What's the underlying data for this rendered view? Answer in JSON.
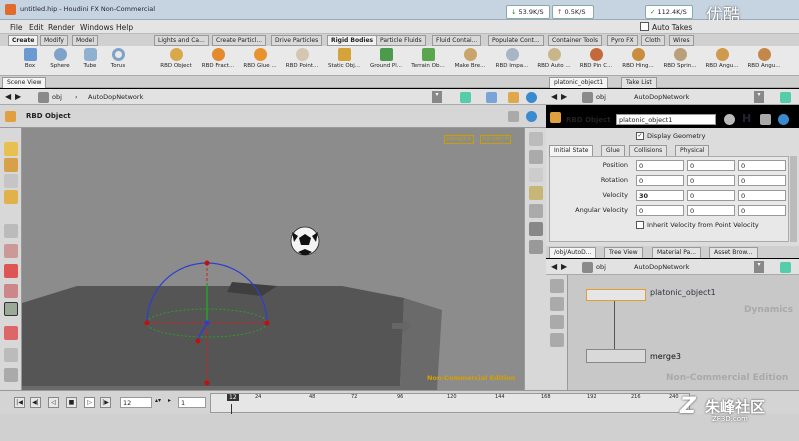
{
  "window": {
    "title": "untitled.hip - Houdini FX Non-Commercial",
    "net_down": "53.9K/S",
    "net_up": "0.5K/S",
    "net_third": "112.4K/S",
    "watermark_top": "优酷"
  },
  "menu": [
    "File",
    "Edit",
    "Render",
    "Windows",
    "Help"
  ],
  "menu_auto_takes": "Auto Takes",
  "shelf_tabs": [
    "Create",
    "Modify",
    "Model",
    "Lights and Ca...",
    "Create Particl...",
    "Drive Particles",
    "Rigid Bodies",
    "Particle Fluids",
    "Fluid Contai...",
    "Populate Cont...",
    "Container Tools",
    "Pyro FX",
    "Cloth",
    "Wires"
  ],
  "shelf_left_tools": [
    "Box",
    "Sphere",
    "Tube",
    "Torus"
  ],
  "shelf_tools": [
    "RBD Object",
    "RBD Fract...",
    "RBD Glue ...",
    "RBD Point...",
    "Static Obj...",
    "Ground Pl...",
    "Terrain Ob...",
    "Make Bre...",
    "RBD Impa...",
    "RBD Auto ...",
    "RBD Pin C...",
    "RBD Hing...",
    "RBD Sprin...",
    "RBD Angu...",
    "RBD Angu..."
  ],
  "left_pane": {
    "tab": "Scene View",
    "path_root": "obj",
    "path_node": "AutoDopNetwork",
    "title": "RBD Object",
    "cam_badge1": "persp1 ▾",
    "cam_badge2": "no cam ▾",
    "watermark": "Non-Commercial Edition"
  },
  "param_pane": {
    "tabs": [
      "platonic_object1",
      "Take List"
    ],
    "path_root": "obj",
    "path_node": "AutoDopNetwork",
    "node_type": "RBD Object",
    "node_name": "platonic_object1",
    "display_geometry": "Display Geometry",
    "subtabs": [
      "Initial State",
      "Glue",
      "Collisions",
      "Physical"
    ],
    "rows": [
      {
        "label": "Position",
        "values": [
          "0",
          "0",
          "0"
        ]
      },
      {
        "label": "Rotation",
        "values": [
          "0",
          "0",
          "0"
        ]
      },
      {
        "label": "Velocity",
        "values": [
          "30",
          "0",
          "0"
        ]
      },
      {
        "label": "Angular Velocity",
        "values": [
          "0",
          "0",
          "0"
        ]
      }
    ],
    "inherit": "Inherit Velocity from Point Velocity"
  },
  "net_pane": {
    "tabs": [
      "/obj/AutoD...",
      "Tree View",
      "Material Pa...",
      "Asset Brow..."
    ],
    "path_root": "obj",
    "path_node": "AutoDopNetwork",
    "context": "Dynamics",
    "node1": "platonic_object1",
    "node2": "merge3",
    "watermark": "Non-Commercial Edition"
  },
  "timeline": {
    "frame": "12",
    "start": "1",
    "ticks": [
      "12",
      "24",
      "48",
      "72",
      "96",
      "120",
      "144",
      "168",
      "192",
      "216",
      "240"
    ],
    "playhead_label": "12"
  },
  "brand_watermark": "朱峰社区",
  "brand_url": "ZF3D.com"
}
